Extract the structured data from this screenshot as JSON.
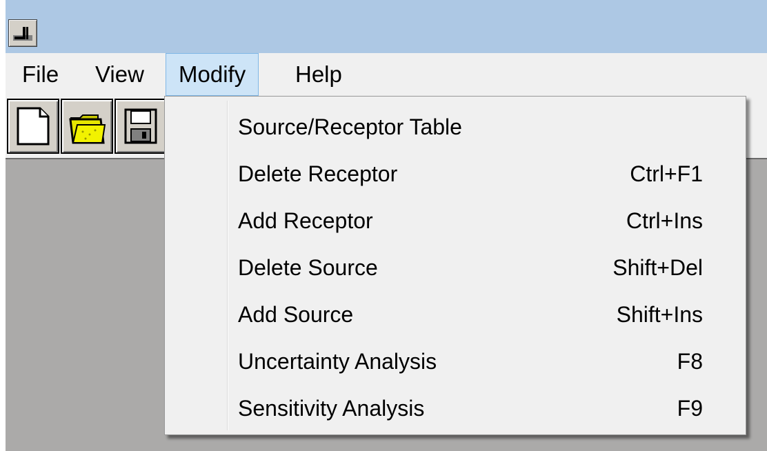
{
  "window": {
    "system_icon": "app-system-icon"
  },
  "menubar": {
    "items": [
      {
        "label": "File"
      },
      {
        "label": "View"
      },
      {
        "label": "Modify"
      },
      {
        "label": "Help"
      }
    ],
    "active_menu": "Modify"
  },
  "toolbar": {
    "buttons": [
      {
        "icon": "new-document-icon"
      },
      {
        "icon": "open-folder-icon"
      },
      {
        "icon": "save-disk-icon"
      }
    ]
  },
  "modify_menu": {
    "items": [
      {
        "label": "Source/Receptor Table",
        "shortcut": ""
      },
      {
        "label": "Delete Receptor",
        "shortcut": "Ctrl+F1"
      },
      {
        "label": "Add Receptor",
        "shortcut": "Ctrl+Ins"
      },
      {
        "label": "Delete Source",
        "shortcut": "Shift+Del"
      },
      {
        "label": "Add Source",
        "shortcut": "Shift+Ins"
      },
      {
        "label": "Uncertainty Analysis",
        "shortcut": "F8"
      },
      {
        "label": "Sensitivity Analysis",
        "shortcut": "F9"
      }
    ]
  },
  "colors": {
    "titlebar": "#adc8e4",
    "menubar": "#f0f0f0",
    "workspace": "#abaaa9",
    "menu_highlight": "#cde4f7",
    "menu_highlight_border": "#7fb6e6"
  }
}
